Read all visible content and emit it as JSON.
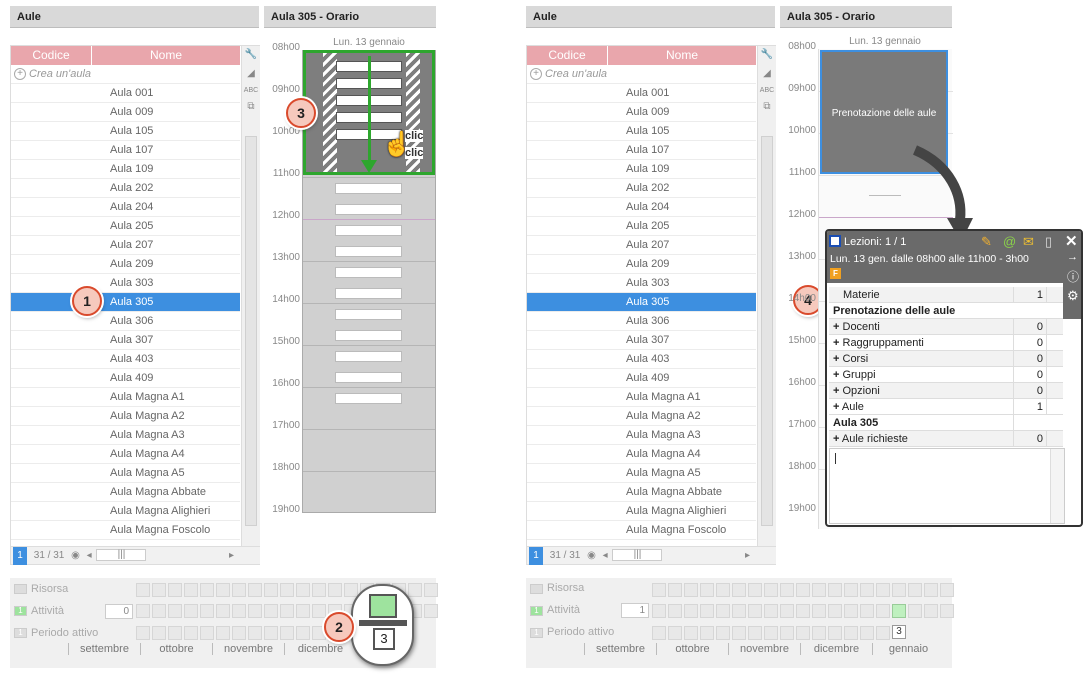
{
  "left": {
    "title": "Aule",
    "col_code": "Codice",
    "col_name": "Nome",
    "create": "Crea un'aula",
    "rooms": [
      "Aula 001",
      "Aula 009",
      "Aula 105",
      "Aula 107",
      "Aula 109",
      "Aula 202",
      "Aula 204",
      "Aula 205",
      "Aula 207",
      "Aula 209",
      "Aula 303",
      "Aula 305",
      "Aula 306",
      "Aula 307",
      "Aula 403",
      "Aula 409",
      "Aula Magna  A1",
      "Aula Magna  A2",
      "Aula Magna  A3",
      "Aula Magna  A4",
      "Aula Magna  A5",
      "Aula Magna Abbate",
      "Aula Magna Alighieri",
      "Aula Magna Foscolo"
    ],
    "selected": "Aula 305",
    "footer_sel": "1",
    "footer_count": "31 / 31",
    "schedule_title": "Aula 305 - Orario",
    "day": "Lun. 13 gennaio",
    "hours": [
      "08h00",
      "09h00",
      "10h00",
      "11h00",
      "12h00",
      "13h00",
      "14h00",
      "15h00",
      "16h00",
      "17h00",
      "18h00",
      "19h00"
    ],
    "click_text": [
      "clic",
      "clic"
    ],
    "resource_label": "Risorsa",
    "activity_label": "Attività",
    "activity_num": "1",
    "activity_value": "0",
    "period_label": "Periodo attivo",
    "period_num": "1",
    "months": [
      "settembre",
      "ottobre",
      "novembre",
      "dicembre"
    ],
    "zoom_week": "3"
  },
  "right": {
    "title": "Aule",
    "col_code": "Codice",
    "col_name": "Nome",
    "create": "Crea un'aula",
    "footer_sel": "1",
    "footer_count": "31 / 31",
    "schedule_title": "Aula 305 - Orario",
    "day": "Lun. 13 gennaio",
    "block_text": "Prenotazione delle aule",
    "resource_label": "Risorsa",
    "activity_label": "Attività",
    "activity_num": "1",
    "activity_value": "1",
    "period_label": "Periodo attivo",
    "period_num": "1",
    "months": [
      "settembre",
      "ottobre",
      "novembre",
      "dicembre",
      "gennaio"
    ],
    "week_cell": "3"
  },
  "popup": {
    "title": "Lezioni: 1 / 1",
    "subtitle": "Lun. 13 gen. dalle 08h00 alle 11h00 - 3h00",
    "flag": "F",
    "materie_label": "Materie",
    "materie_value": "1",
    "section1": "Prenotazione delle aule",
    "rows": [
      {
        "label": "Docenti",
        "value": "0"
      },
      {
        "label": "Raggruppamenti",
        "value": "0"
      },
      {
        "label": "Corsi",
        "value": "0"
      },
      {
        "label": "Gruppi",
        "value": "0"
      },
      {
        "label": "Opzioni",
        "value": "0"
      },
      {
        "label": "Aule",
        "value": "1"
      }
    ],
    "section2": "Aula 305",
    "requested_label": "Aule richieste",
    "requested_value": "0"
  },
  "badges": [
    "1",
    "2",
    "3",
    "4"
  ],
  "colors": {
    "selection": "#3d8fe0",
    "header_pink": "#e9a6ac",
    "green": "#2ea62e",
    "badge_border": "#d94a2c"
  }
}
